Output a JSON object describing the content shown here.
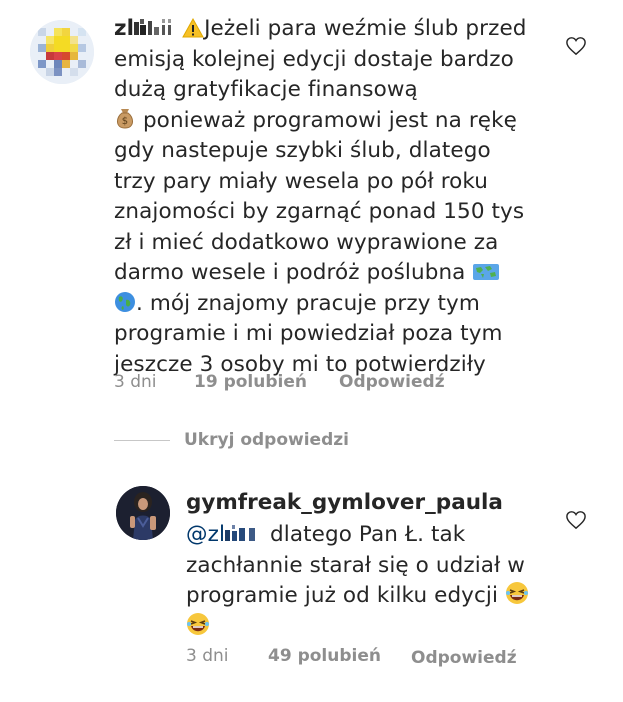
{
  "comment": {
    "username_partial": "zl",
    "text": "Jeżeli para weźmie ślub przed emisją kolejnej edycji dostaje bardzo dużą gratyfikacje finansową",
    "text_2": "ponieważ programowi jest na rękę gdy nastepuje szybki ślub, dlatego trzy pary miały wesela po pół roku znajomości by zgarnąć ponad 150 tys zł i mieć dodatkowo  wyprawione za darmo wesele i podróż poślubna",
    "text_3": ". mój znajomy pracuje przy tym programie i mi powiedział poza tym jeszcze 3 osoby mi to potwierdziły",
    "time": "3 dni",
    "likes": "19 polubień",
    "reply_label": "Odpowiedź",
    "icons": [
      "warning-icon",
      "money-bag-icon",
      "world-map-icon",
      "globe-icon",
      "heart-icon"
    ]
  },
  "hide_replies": "Ukryj odpowiedzi",
  "reply": {
    "username": "gymfreak_gymlover_paula",
    "mention": "@zl",
    "text": " dlatego Pan Ł. tak zachłannie starał się o udział w programie już od kilku edycji",
    "time": "3 dni",
    "likes": "49 polubień",
    "reply_label": "Odpowiedź",
    "icons": [
      "laughing-emoji-icon",
      "heart-icon"
    ]
  },
  "colors": {
    "text": "#262626",
    "secondary": "#8e8e8e",
    "mention": "#00376b",
    "divider": "#c7c7c7"
  }
}
